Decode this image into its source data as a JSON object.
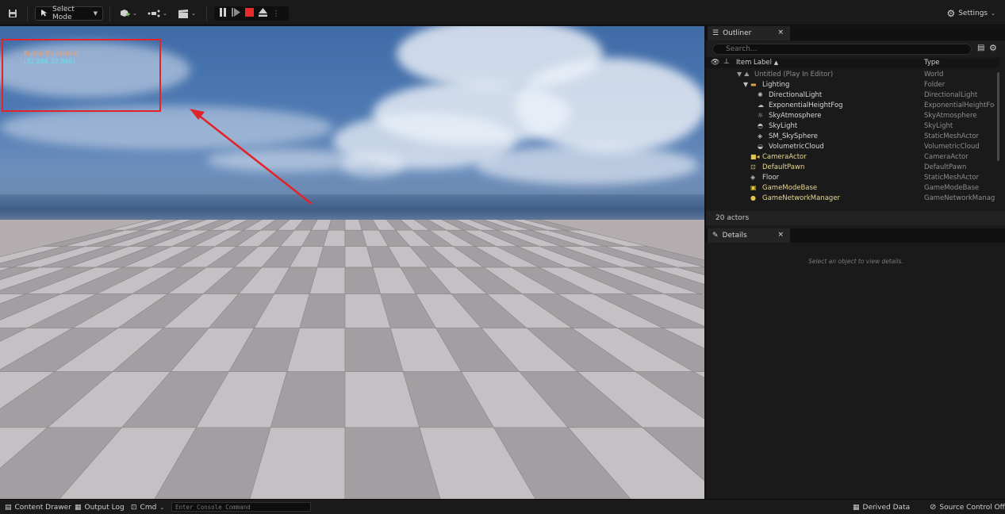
{
  "toolbar": {
    "select_mode_label": "Select Mode",
    "settings_label": "Settings"
  },
  "viewport": {
    "debug_line1": "Button0's state 0",
    "debug_line2": "(32,896,32,896)"
  },
  "outliner": {
    "tab_label": "Outliner",
    "search_placeholder": "Search...",
    "col_label": "Item Label",
    "col_type": "Type",
    "rows": [
      {
        "label": "Untitled (Play In Editor)",
        "type": "World"
      },
      {
        "label": "Lighting",
        "type": "Folder"
      },
      {
        "label": "DirectionalLight",
        "type": "DirectionalLight"
      },
      {
        "label": "ExponentialHeightFog",
        "type": "ExponentialHeightFog"
      },
      {
        "label": "SkyAtmosphere",
        "type": "SkyAtmosphere"
      },
      {
        "label": "SkyLight",
        "type": "SkyLight"
      },
      {
        "label": "SM_SkySphere",
        "type": "StaticMeshActor"
      },
      {
        "label": "VolumetricCloud",
        "type": "VolumetricCloud"
      },
      {
        "label": "CameraActor",
        "type": "CameraActor"
      },
      {
        "label": "DefaultPawn",
        "type": "DefaultPawn"
      },
      {
        "label": "Floor",
        "type": "StaticMeshActor"
      },
      {
        "label": "GameModeBase",
        "type": "GameModeBase"
      },
      {
        "label": "GameNetworkManager",
        "type": "GameNetworkManager"
      }
    ],
    "actor_count": "20 actors"
  },
  "details": {
    "tab_label": "Details",
    "hint": "Select an object to view details."
  },
  "bottombar": {
    "content_drawer": "Content Drawer",
    "output_log": "Output Log",
    "cmd": "Cmd",
    "console_placeholder": "Enter Console Command",
    "derived_data": "Derived Data",
    "source_control": "Source Control Off"
  },
  "colors": {
    "highlight": "#e2232a",
    "debug_orange": "#f1a06a",
    "debug_cyan": "#5fe6f2"
  }
}
